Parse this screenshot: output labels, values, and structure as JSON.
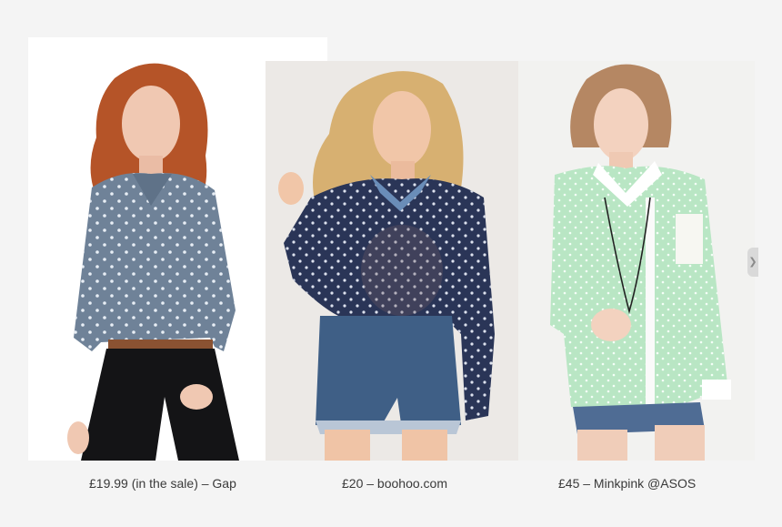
{
  "products": [
    {
      "caption": "£19.99 (in the sale) – Gap",
      "image": "woman-in-chambray-polka-dot-shirt"
    },
    {
      "caption": "£20 – boohoo.com",
      "image": "woman-in-navy-sheer-polka-dot-shirt"
    },
    {
      "caption": "£45 – Minkpink @ASOS",
      "image": "woman-in-mint-sheer-polka-dot-shirt"
    }
  ],
  "colors": {
    "background": "#f4f4f4",
    "chambray": "#6f8298",
    "navy": "#2a3557",
    "mint": "#b9e6c4",
    "caption_text": "#3a3a3a"
  }
}
